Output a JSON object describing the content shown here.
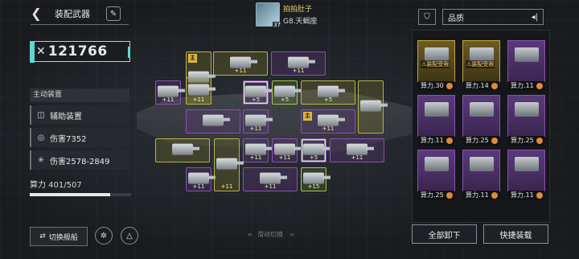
{
  "header": {
    "title": "装配武器",
    "back_icon": "back-arrow-icon",
    "edit_icon": "pen-icon"
  },
  "player": {
    "name": "拍拍肚子",
    "level": "37",
    "rank": "G8.天蝎座"
  },
  "power": {
    "value": "121766"
  },
  "stats": {
    "section_label": "主动装置",
    "rows": [
      {
        "icon": "shield-icon",
        "text": "辅助装置"
      },
      {
        "icon": "target-icon",
        "text": "伤害7352"
      },
      {
        "icon": "burst-icon",
        "text": "伤害2578-2849"
      }
    ]
  },
  "load": {
    "label": "算力",
    "current": 401,
    "max": 507,
    "text": "算力  401/507"
  },
  "bottom": {
    "switch_ship": "切换舰船",
    "swipe_hint": "滑动切换"
  },
  "slots": [
    {
      "color": "yellow",
      "plus": "",
      "main": "主"
    },
    {
      "color": "yellow",
      "plus": "+11",
      "main": ""
    },
    {
      "color": "purple",
      "plus": "+11",
      "main": ""
    },
    {
      "color": "purple",
      "plus": "+11",
      "main": ""
    },
    {
      "color": "yellow",
      "plus": "+11",
      "main": ""
    },
    {
      "color": "purple",
      "plus": "+5",
      "main": ""
    },
    {
      "color": "green",
      "plus": "+5",
      "main": ""
    },
    {
      "color": "yellow",
      "plus": "+5",
      "main": ""
    },
    {
      "color": "yellow",
      "plus": "",
      "main": ""
    },
    {
      "color": "purple",
      "plus": "",
      "main": ""
    },
    {
      "color": "purple",
      "plus": "+11",
      "main": ""
    },
    {
      "color": "purple",
      "plus": "+11",
      "main": "主"
    },
    {
      "color": "yellow",
      "plus": "",
      "main": ""
    },
    {
      "color": "purple",
      "plus": "+11",
      "main": ""
    },
    {
      "color": "purple",
      "plus": "+11",
      "main": ""
    },
    {
      "color": "purple",
      "plus": "+5",
      "main": ""
    },
    {
      "color": "purple",
      "plus": "+11",
      "main": ""
    },
    {
      "color": "purple",
      "plus": "+11",
      "main": ""
    },
    {
      "color": "yellow",
      "plus": "+11",
      "main": ""
    },
    {
      "color": "purple",
      "plus": "+11",
      "main": ""
    },
    {
      "color": "green",
      "plus": "+15",
      "main": ""
    }
  ],
  "inventory": {
    "sort_label": "品质",
    "cards": [
      {
        "color": "yellow",
        "lock": "装配受限",
        "power": "算力.30"
      },
      {
        "color": "yellow",
        "lock": "装配受限",
        "power": "算力.14"
      },
      {
        "color": "purple",
        "lock": "",
        "power": "算力.11"
      },
      {
        "color": "purple",
        "lock": "",
        "power": "算力.11"
      },
      {
        "color": "purple",
        "lock": "",
        "power": "算力.25"
      },
      {
        "color": "purple",
        "lock": "",
        "power": "算力.25"
      },
      {
        "color": "purple",
        "lock": "",
        "power": "算力.25"
      },
      {
        "color": "purple",
        "lock": "",
        "power": "算力.11"
      },
      {
        "color": "purple",
        "lock": "",
        "power": "算力.11"
      }
    ],
    "unequip_all": "全部卸下",
    "quick_equip": "快捷装载"
  }
}
